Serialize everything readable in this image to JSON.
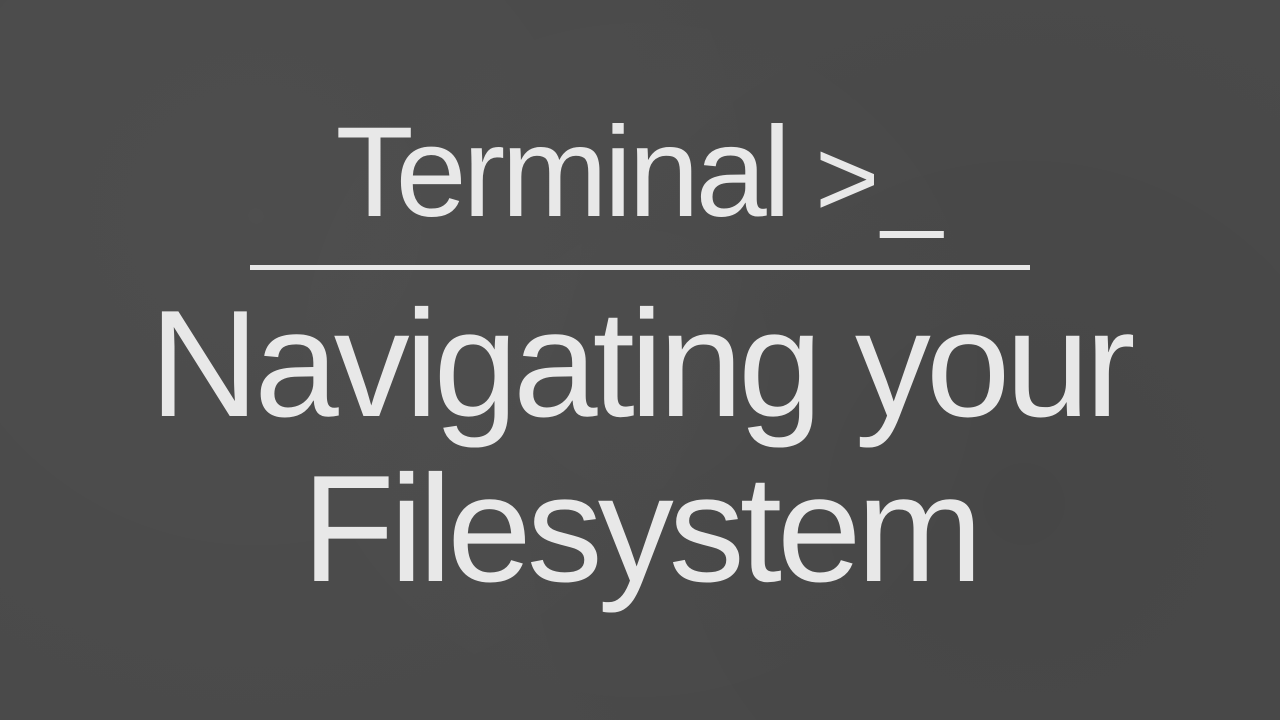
{
  "title": {
    "main": "Terminal",
    "prompt": ">_"
  },
  "subtitle": {
    "line1": "Navigating your",
    "line2": "Filesystem"
  }
}
